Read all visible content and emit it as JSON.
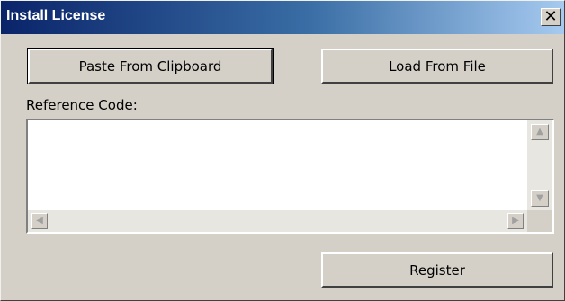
{
  "window": {
    "title": "Install License",
    "close_glyph": "✕"
  },
  "buttons": {
    "paste_label": "Paste From Clipboard",
    "load_label": "Load From File",
    "register_label": "Register"
  },
  "reference": {
    "label": "Reference Code:",
    "value": ""
  },
  "scrollbar": {
    "up_icon": "▲",
    "down_icon": "▼",
    "left_icon": "◀",
    "right_icon": "▶"
  },
  "colors": {
    "titlebar_start": "#0a246a",
    "titlebar_end": "#a6caf0",
    "dialog_face": "#d4d0c8"
  }
}
